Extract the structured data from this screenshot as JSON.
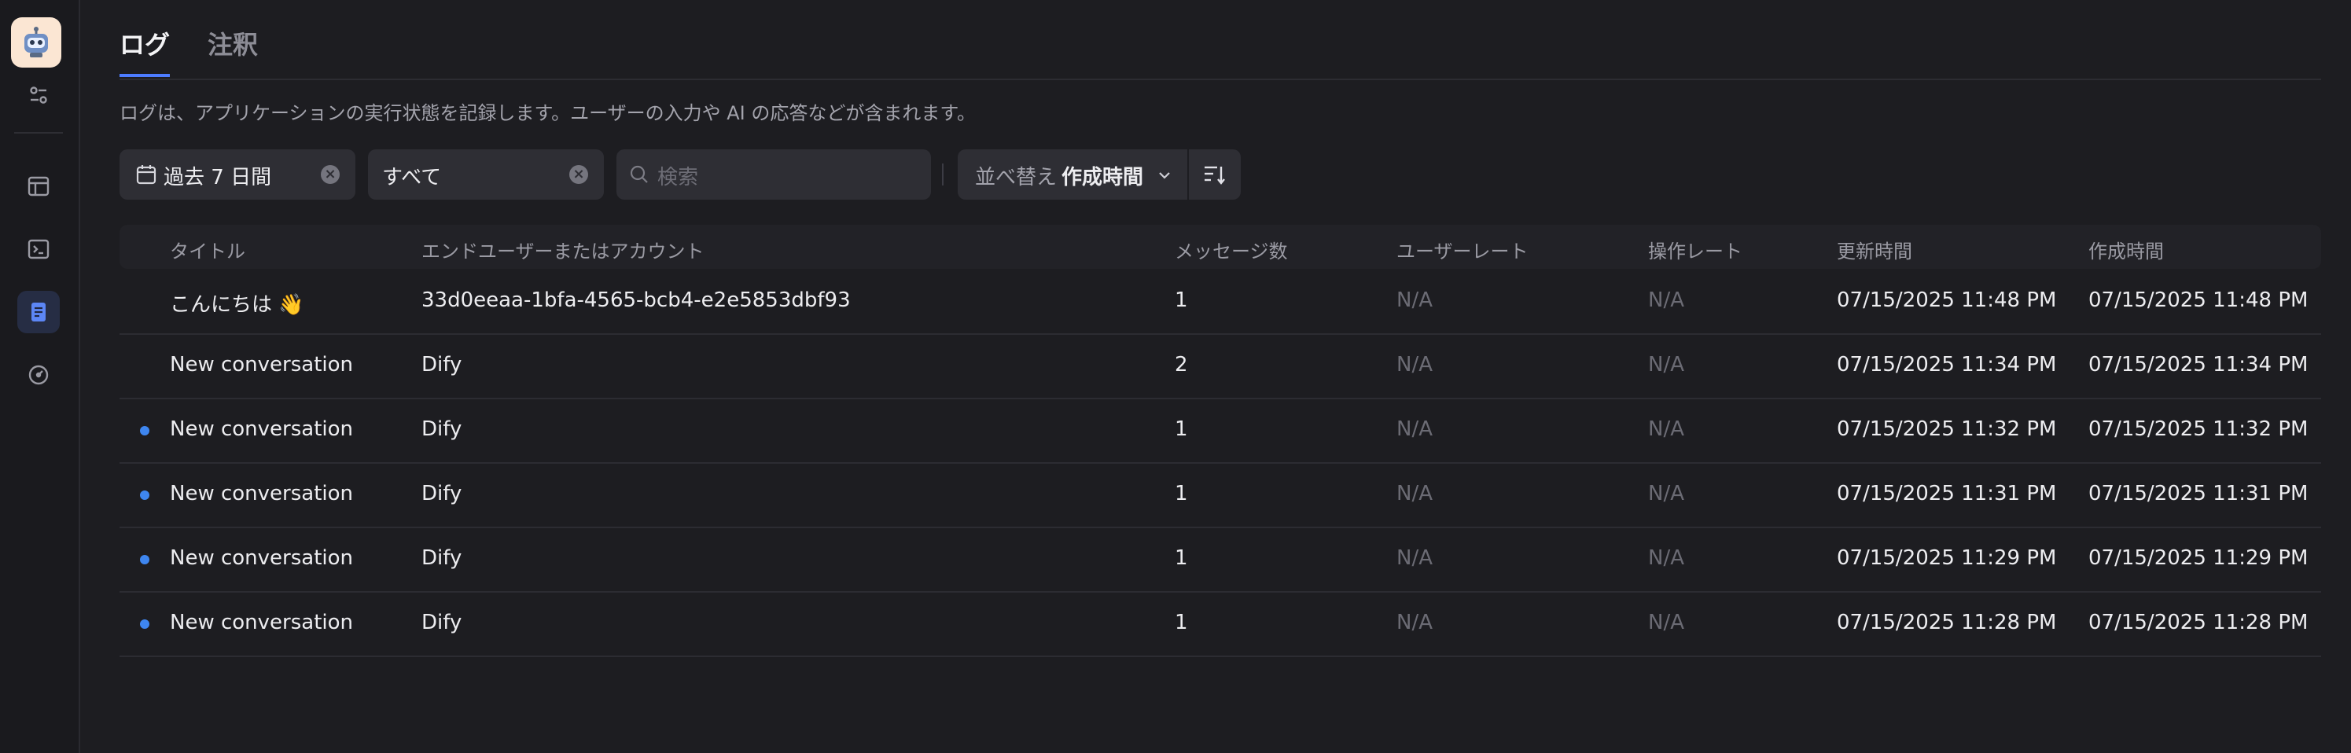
{
  "tabs": [
    {
      "label": "ログ",
      "active": true
    },
    {
      "label": "注釈",
      "active": false
    }
  ],
  "description": "ログは、アプリケーションの実行状態を記録します。ユーザーの入力や AI の応答などが含まれます。",
  "filters": {
    "period": "過去 7 日間",
    "status": "すべて",
    "search_placeholder": "検索",
    "sort_prefix": "並べ替え",
    "sort_value": "作成時間"
  },
  "table": {
    "columns": [
      "タイトル",
      "エンドユーザーまたはアカウント",
      "メッセージ数",
      "ユーザーレート",
      "操作レート",
      "更新時間",
      "作成時間"
    ],
    "rows": [
      {
        "unread": false,
        "title": "こんにちは 👋",
        "user": "33d0eeaa-1bfa-4565-bcb4-e2e5853dbf93",
        "messages": "1",
        "user_rate": "N/A",
        "op_rate": "N/A",
        "updated": "07/15/2025 11:48 PM",
        "created": "07/15/2025 11:48 PM"
      },
      {
        "unread": false,
        "title": "New conversation",
        "user": "Dify",
        "messages": "2",
        "user_rate": "N/A",
        "op_rate": "N/A",
        "updated": "07/15/2025 11:34 PM",
        "created": "07/15/2025 11:34 PM"
      },
      {
        "unread": true,
        "title": "New conversation",
        "user": "Dify",
        "messages": "1",
        "user_rate": "N/A",
        "op_rate": "N/A",
        "updated": "07/15/2025 11:32 PM",
        "created": "07/15/2025 11:32 PM"
      },
      {
        "unread": true,
        "title": "New conversation",
        "user": "Dify",
        "messages": "1",
        "user_rate": "N/A",
        "op_rate": "N/A",
        "updated": "07/15/2025 11:31 PM",
        "created": "07/15/2025 11:31 PM"
      },
      {
        "unread": true,
        "title": "New conversation",
        "user": "Dify",
        "messages": "1",
        "user_rate": "N/A",
        "op_rate": "N/A",
        "updated": "07/15/2025 11:29 PM",
        "created": "07/15/2025 11:29 PM"
      },
      {
        "unread": true,
        "title": "New conversation",
        "user": "Dify",
        "messages": "1",
        "user_rate": "N/A",
        "op_rate": "N/A",
        "updated": "07/15/2025 11:28 PM",
        "created": "07/15/2025 11:28 PM"
      }
    ]
  },
  "colors": {
    "accent": "#4d7cff",
    "unread_dot": "#3e86f0",
    "background": "#1d1d21"
  },
  "sidebar": {
    "icons": [
      "robot-avatar-icon",
      "settings-sliders-icon",
      "layout-icon",
      "terminal-icon",
      "logs-document-icon",
      "gauge-icon"
    ],
    "active": "logs-document-icon"
  }
}
